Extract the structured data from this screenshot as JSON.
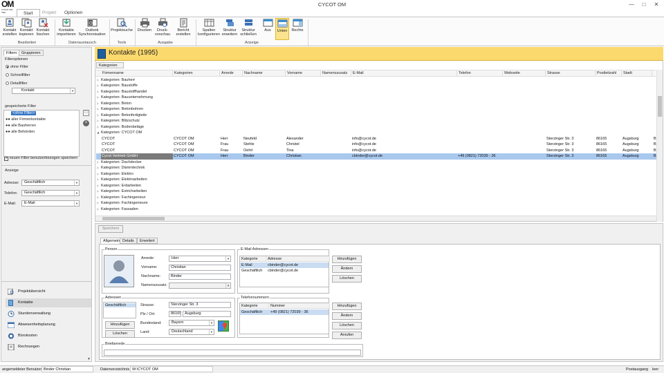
{
  "app": {
    "logo": "OM",
    "logo_sub": "CYCOT OM · TEIL",
    "title": "CYCOT OM"
  },
  "tabs": [
    {
      "label": "Start"
    },
    {
      "label": "Projekt"
    },
    {
      "label": "Optionen"
    }
  ],
  "ribbon": {
    "groups": [
      "Bearbeiten",
      "Datenaustausch",
      "Tools",
      "Ausgabe",
      "Anzeige"
    ],
    "buttons": [
      {
        "label": "Kontakt erstellen"
      },
      {
        "label": "Kontakt kopieren"
      },
      {
        "label": "Kontakt löschen"
      },
      {
        "label": "Kontakte importieren"
      },
      {
        "label": "Outlook Synchronisation"
      },
      {
        "label": "Projektsuche"
      },
      {
        "label": "Drucken"
      },
      {
        "label": "Druck-vorschau"
      },
      {
        "label": "Bericht erstellen"
      },
      {
        "label": "Spalten konfigurieren"
      },
      {
        "label": "Struktur erweitern"
      },
      {
        "label": "Struktur schließen"
      },
      {
        "label": "Aus"
      },
      {
        "label": "Unten"
      },
      {
        "label": "Rechts"
      }
    ]
  },
  "left": {
    "tabs": [
      "Filtern",
      "Gruppieren"
    ],
    "filteroptions_label": "Filteroptionen",
    "radios": [
      "ohne Filter",
      "Schnellfilter",
      "Detailfilter"
    ],
    "detail_combo": "Kontakt",
    "saved_label": "gespeicherte Filter",
    "saved": [
      "<ohne Filter>",
      "aller Firmenkontakte",
      "alle Bauherren",
      "alle Behörden"
    ],
    "checkbox_label": "neuen Filter benutzerbezogen speichern",
    "anzeige_label": "Anzeige",
    "anzeige": [
      {
        "label": "Adresse:",
        "value": "Geschäftlich"
      },
      {
        "label": "Telefon:",
        "value": "Geschäftlich"
      },
      {
        "label": "E-Mail:",
        "value": "E-Mail"
      }
    ],
    "nav": [
      "Projektübersicht",
      "Kontakte",
      "Stundenverwaltung",
      "Abwesenheitsplanung",
      "Bürokosten",
      "Rechnungen"
    ]
  },
  "main": {
    "title": "Kontakte (1995)",
    "group_box": "Kategorien",
    "columns": [
      "Firmenname",
      "Kategorien",
      "Anrede",
      "Nachname",
      "Vorname",
      "Namenszusatz",
      "E-Mail",
      "Telefon",
      "Webseite",
      "Strasse",
      "Postleitzahl",
      "Stadt"
    ],
    "groups_before": [
      "Kategorien: Bauherr",
      "Kategorien: Baustoffe",
      "Kategorien: Baustoffhandel",
      "Kategorien: Bauunternehmung",
      "Kategorien: Beton",
      "Kategorien: Betonbohren",
      "Kategorien: Betonfertigteile",
      "Kategorien: Blitzschutz",
      "Kategorien: Bodenbeläge",
      "Kategorien: CYCOT OM"
    ],
    "rows": [
      {
        "firma": "CYCOT",
        "kat": "CYCOT OM",
        "anrede": "Herr",
        "nachname": "Neufeld",
        "vorname": "Alexander",
        "email": "info@cycot.de",
        "telefon": "",
        "strasse": "Sterzinger Str. 3",
        "plz": "86165",
        "stadt": "Augsburg",
        "more": "B"
      },
      {
        "firma": "CYCOT",
        "kat": "CYCOT OM",
        "anrede": "Frau",
        "nachname": "Stehle",
        "vorname": "Christel",
        "email": "info@cycot.de",
        "telefon": "",
        "strasse": "Sterzinger Str. 3",
        "plz": "86165",
        "stadt": "Augsburg",
        "more": "B"
      },
      {
        "firma": "CYCOT",
        "kat": "CYCOT OM",
        "anrede": "Frau",
        "nachname": "Oehrl",
        "vorname": "Tina",
        "email": "info@cycot.de",
        "telefon": "",
        "strasse": "Sterzinger Str. 3",
        "plz": "86165",
        "stadt": "Augsburg",
        "more": "B"
      },
      {
        "firma": "Cycot Vertrieb GmbH",
        "kat": "CYCOT OM",
        "anrede": "Herr",
        "nachname": "Binder",
        "vorname": "Christian",
        "email": "cbinder@cycot.de",
        "telefon": "+49 (0821) 72039 - 36",
        "strasse": "Sterzinger Str. 3",
        "plz": "86165",
        "stadt": "Augsburg",
        "more": "B"
      }
    ],
    "groups_after": [
      "Kategorien: Dachdecker",
      "Kategorien: Dämmtechnik",
      "Kategorien: Elektro",
      "Kategorien: Elektroarbeiten",
      "Kategorien: Erdarbeiten",
      "Kategorien: Estricharbeiten",
      "Kategorien: Fachingenieur",
      "Kategorien: Fachingenieure",
      "Kategorien: Fassaden"
    ]
  },
  "detail": {
    "save": "Speichern",
    "tabs": [
      "Allgemein",
      "Details",
      "Erweitert"
    ],
    "person_label": "Person",
    "person": [
      {
        "label": "Anrede:",
        "value": "Herr"
      },
      {
        "label": "Vorname:",
        "value": "Christian"
      },
      {
        "label": "Nachname:",
        "value": "Binder"
      },
      {
        "label": "Namenszusatz:",
        "value": ""
      }
    ],
    "email_label": "E-Mail Adressen",
    "email_cols": [
      "Kategorie",
      "Adresse"
    ],
    "emails": [
      {
        "k": "E-Mail",
        "v": "cbinder@cycot.de"
      },
      {
        "k": "Geschäftlich",
        "v": "cbinder@cycot.de"
      }
    ],
    "email_buttons": [
      "Hinzufügen",
      "Ändern",
      "Löschen"
    ],
    "addr_label": "Adressen",
    "addr_list": [
      "Geschäftlich"
    ],
    "addr_buttons": [
      "Hinzufügen",
      "Löschen"
    ],
    "addr": {
      "strasse_l": "Strasse:",
      "strasse": "Sterzinger Str. 3",
      "plz_l": "Plz / Ort:",
      "plz": "86165",
      "ort": "Augsburg",
      "bl_l": "Bundesland:",
      "bl": "Bayern",
      "land_l": "Land:",
      "land": "Deutschland"
    },
    "tel_label": "Telefonnummern",
    "tel_cols": [
      "Kategorie",
      "Nummer"
    ],
    "tels": [
      {
        "k": "Geschäftlich",
        "v": "+49 (0821) 72039 - 36"
      }
    ],
    "tel_buttons": [
      "Hinzufügen",
      "Ändern",
      "Löschen",
      "Anrufen"
    ],
    "brief_label": "Briefanrede"
  },
  "status": {
    "user_label": "angemeldeter Benutzer",
    "user": "Binder Christian",
    "dir_label": "Datenverzeichnis",
    "dir": "W:\\CYCOT OM",
    "po_label": "Postausgang",
    "po": "leer"
  },
  "colors": {
    "accent": "#fcd96d",
    "highlight": "#fbe38e",
    "selection": "#a9c8ee"
  }
}
